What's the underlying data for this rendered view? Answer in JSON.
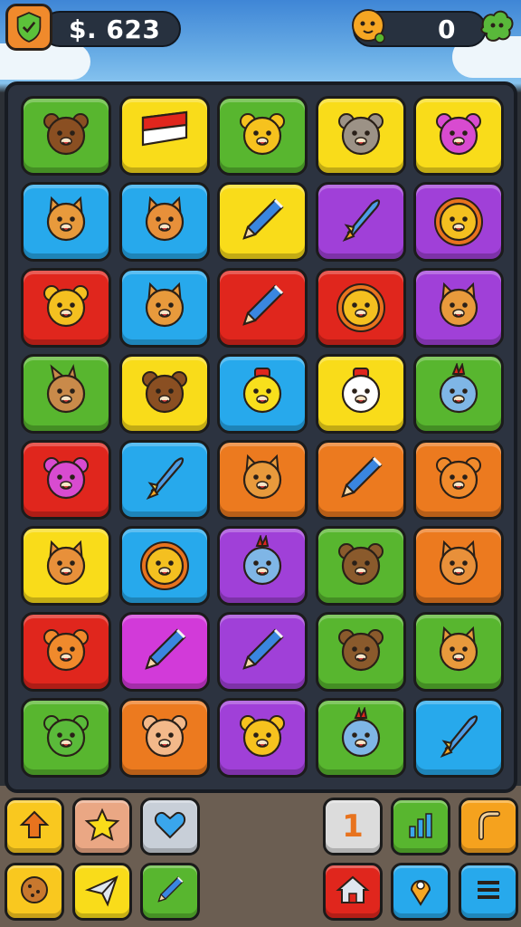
{
  "hud": {
    "money_label": "$. 623",
    "counter_value": "0"
  },
  "colors": {
    "green": "#58b62f",
    "yellow": "#f9dc1a",
    "blue": "#27a9ec",
    "purple": "#a040d8",
    "red": "#e0261d",
    "orange": "#ec7a1f",
    "magenta": "#d23ad9",
    "board_bg": "#2c3340"
  },
  "board": {
    "columns": 5,
    "rows": 8,
    "tiles": [
      {
        "color": "green",
        "icon": "monkey-face-icon"
      },
      {
        "color": "yellow",
        "icon": "flag-icon"
      },
      {
        "color": "green",
        "icon": "bear-face-icon"
      },
      {
        "color": "yellow",
        "icon": "koala-face-icon"
      },
      {
        "color": "yellow",
        "icon": "pink-monster-icon"
      },
      {
        "color": "blue",
        "icon": "fox-face-icon"
      },
      {
        "color": "blue",
        "icon": "cat-face-icon"
      },
      {
        "color": "yellow",
        "icon": "pencil-icon"
      },
      {
        "color": "purple",
        "icon": "rocket-icon"
      },
      {
        "color": "purple",
        "icon": "lion-face-icon"
      },
      {
        "color": "red",
        "icon": "mouse-face-icon"
      },
      {
        "color": "blue",
        "icon": "fox-face-icon"
      },
      {
        "color": "red",
        "icon": "pencil-icon"
      },
      {
        "color": "red",
        "icon": "lion-face-icon"
      },
      {
        "color": "purple",
        "icon": "fox-face-icon"
      },
      {
        "color": "green",
        "icon": "bunny-face-icon"
      },
      {
        "color": "yellow",
        "icon": "monkey-face-icon"
      },
      {
        "color": "blue",
        "icon": "chick-face-icon"
      },
      {
        "color": "yellow",
        "icon": "clown-face-icon"
      },
      {
        "color": "green",
        "icon": "blue-monster-icon"
      },
      {
        "color": "red",
        "icon": "pink-monster-icon"
      },
      {
        "color": "blue",
        "icon": "rocket-icon"
      },
      {
        "color": "orange",
        "icon": "fox-face-icon"
      },
      {
        "color": "orange",
        "icon": "pencil-icon"
      },
      {
        "color": "orange",
        "icon": "tiger-face-icon"
      },
      {
        "color": "yellow",
        "icon": "cat-face-icon"
      },
      {
        "color": "blue",
        "icon": "lion-face-icon"
      },
      {
        "color": "purple",
        "icon": "blue-monster-icon"
      },
      {
        "color": "green",
        "icon": "otter-face-icon"
      },
      {
        "color": "orange",
        "icon": "cat-face-icon"
      },
      {
        "color": "red",
        "icon": "tiger-face-icon"
      },
      {
        "color": "magenta",
        "icon": "pencil-icon"
      },
      {
        "color": "purple",
        "icon": "pencil-icon"
      },
      {
        "color": "green",
        "icon": "otter-face-icon"
      },
      {
        "color": "green",
        "icon": "fox-face-icon"
      },
      {
        "color": "green",
        "icon": "green-monster-icon"
      },
      {
        "color": "orange",
        "icon": "hamster-face-icon"
      },
      {
        "color": "purple",
        "icon": "bear-face-icon"
      },
      {
        "color": "green",
        "icon": "blue-monster-icon"
      },
      {
        "color": "blue",
        "icon": "rocket-icon"
      }
    ]
  },
  "toolbar": {
    "left_top": [
      {
        "icon": "arrow-up-icon",
        "color": "#f9c81f"
      },
      {
        "icon": "star-icon",
        "color": "#eaa784"
      },
      {
        "icon": "heart-icon",
        "color": "#c8cfd8"
      }
    ],
    "left_bottom": [
      {
        "icon": "cookie-icon",
        "color": "#f9c81f"
      },
      {
        "icon": "paper-plane-icon",
        "color": "#f9dc1a"
      },
      {
        "icon": "pencil-icon",
        "color": "#58b62f"
      }
    ],
    "right_top": [
      {
        "icon": "level-number-icon",
        "color": "#dcdcdc",
        "label": "1"
      },
      {
        "icon": "chart-icon",
        "color": "#58b62f"
      },
      {
        "icon": "hook-icon",
        "color": "#f5a21e"
      }
    ],
    "right_bottom": [
      {
        "icon": "home-icon",
        "color": "#e0261d"
      },
      {
        "icon": "location-pin-icon",
        "color": "#27a9ec"
      },
      {
        "icon": "menu-icon",
        "color": "#27a9ec"
      }
    ]
  }
}
